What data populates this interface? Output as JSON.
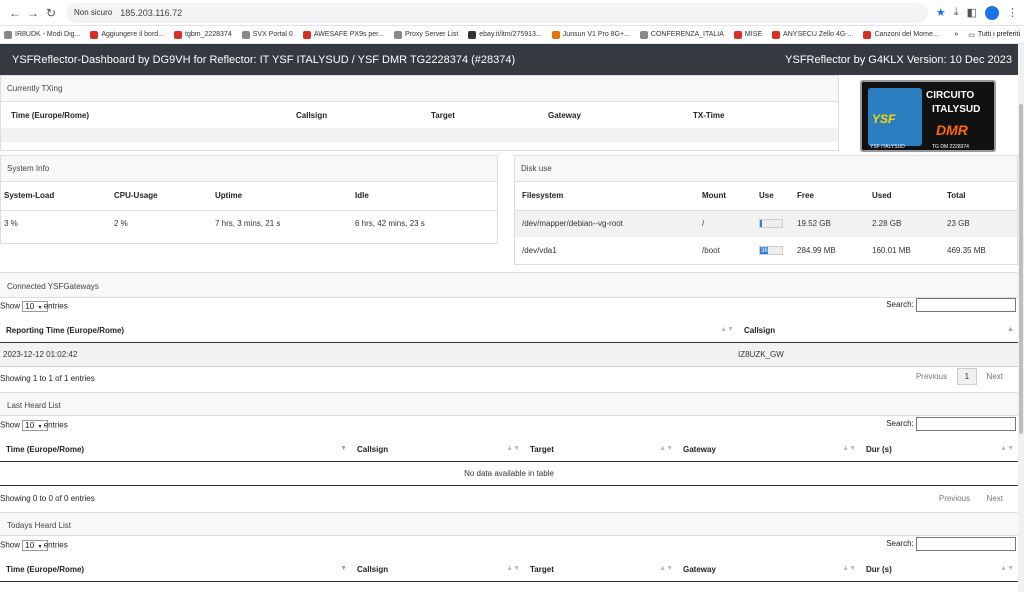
{
  "browser": {
    "security": "Non sicuro",
    "url": "185.203.116.72",
    "bookmarks": [
      "IR8UDK - Modi Dig...",
      "Aggiungere il bord...",
      "tgbm_2228374",
      "SVX Portal 0",
      "AWESAFE PX9s per...",
      "Proxy Server List",
      "ebay.it/itm/275913...",
      "Junsun V1 Pro 8G+...",
      "CONFERENZA_ITALIA",
      "MISE",
      "ANYSECU Zello 4G-...",
      "Canzoni del Mome..."
    ],
    "bookmarks_more": "»",
    "all_bookmarks": "Tutti i preferiti"
  },
  "header": {
    "title": "YSFReflector-Dashboard by DG9VH for Reflector: IT YSF ITALYSUD / YSF DMR TG2228374 (#28374)",
    "version": "YSFReflector by G4KLX Version: 10 Dec 2023"
  },
  "logo": {
    "line1": "CIRCUITO",
    "line2": "ITALYSUD",
    "ysf": "YSF",
    "dmr": "DMR",
    "sub_left": "YSF ITALYSUD",
    "sub_right": "TG DM 2228374"
  },
  "currently_txing": {
    "title": "Currently TXing",
    "columns": [
      "Time (Europe/Rome)",
      "Callsign",
      "Target",
      "Gateway",
      "TX-Time"
    ]
  },
  "system_info": {
    "title": "System Info",
    "columns": [
      "System-Load",
      "CPU-Usage",
      "Uptime",
      "Idle"
    ],
    "values": [
      "3 %",
      "2 %",
      "7 hrs, 3 mins, 21 s",
      "6 hrs, 42 mins, 23 s"
    ]
  },
  "disk_use": {
    "title": "Disk use",
    "columns": [
      "Filesystem",
      "Mount",
      "Use",
      "Free",
      "Used",
      "Total"
    ],
    "rows": [
      {
        "fs": "/dev/mapper/debian--vg-root",
        "mount": "/",
        "use_pct": 10,
        "use_label": "",
        "free": "19.52 GB",
        "used": "2.28 GB",
        "total": "23 GB"
      },
      {
        "fs": "/dev/vda1",
        "mount": "/boot",
        "use_pct": 36,
        "use_label": "36",
        "free": "284.99 MB",
        "used": "160.01 MB",
        "total": "469.35 MB"
      }
    ]
  },
  "gateways": {
    "title": "Connected YSFGateways",
    "show": "Show",
    "entries": "entries",
    "page_size": "10",
    "search": "Search:",
    "columns": [
      "Reporting Time (Europe/Rome)",
      "Callsign"
    ],
    "rows": [
      [
        "2023-12-12 01:02:42",
        "IZ8UZK_GW"
      ]
    ],
    "info": "Showing 1 to 1 of 1 entries",
    "prev": "Previous",
    "page": "1",
    "next": "Next"
  },
  "last_heard": {
    "title": "Last Heard List",
    "show": "Show",
    "entries": "entries",
    "page_size": "10",
    "search": "Search:",
    "columns": [
      "Time (Europe/Rome)",
      "Callsign",
      "Target",
      "Gateway",
      "Dur (s)"
    ],
    "empty": "No data available in table",
    "info": "Showing 0 to 0 of 0 entries",
    "prev": "Previous",
    "next": "Next"
  },
  "todays_heard": {
    "title": "Todays Heard List",
    "show": "Show",
    "entries": "entries",
    "page_size": "10",
    "search": "Search:",
    "columns": [
      "Time (Europe/Rome)",
      "Callsign",
      "Target",
      "Gateway",
      "Dur (s)"
    ]
  }
}
